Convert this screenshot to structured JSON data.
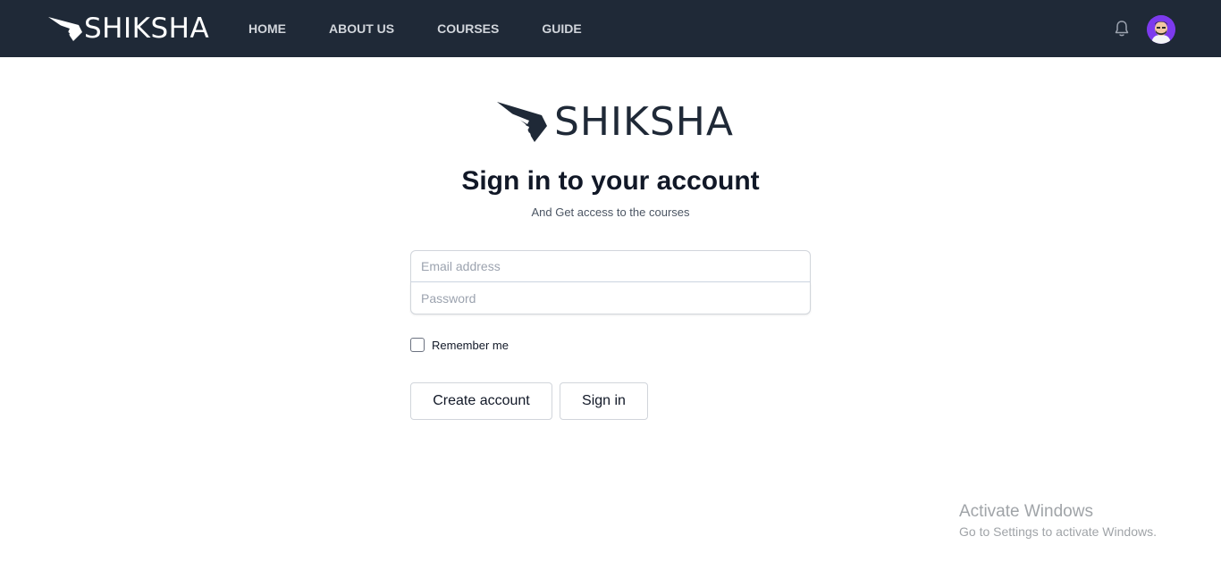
{
  "navbar": {
    "brand": "SHIKSHA",
    "links": [
      "HOME",
      "ABOUT US",
      "COURSES",
      "GUIDE"
    ],
    "bell_icon": "bell-icon",
    "avatar_icon": "user-avatar"
  },
  "main": {
    "logo_text": "SHIKSHA",
    "title": "Sign in to your account",
    "subtitle": "And Get access to the courses",
    "email_placeholder": "Email address",
    "password_placeholder": "Password",
    "remember_label": "Remember me",
    "create_button": "Create account",
    "signin_button": "Sign in"
  },
  "watermark": {
    "title": "Activate Windows",
    "subtitle": "Go to Settings to activate Windows."
  },
  "colors": {
    "navbar_bg": "#1f2937",
    "avatar_bg": "#7c3aed"
  }
}
